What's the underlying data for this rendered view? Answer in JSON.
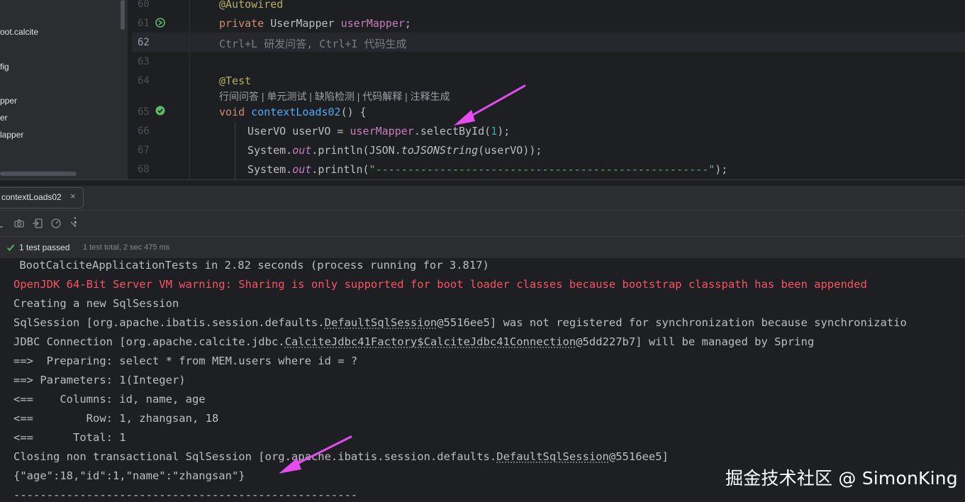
{
  "project_tree": {
    "items": [
      "oot.calcite",
      "fig",
      "pper",
      "er",
      "lapper"
    ]
  },
  "editor": {
    "line_numbers": [
      "60",
      "61",
      "62",
      "63",
      "64",
      "65",
      "66",
      "67",
      "68"
    ],
    "lines": {
      "l60": "@Autowired",
      "l61_kw": "private",
      "l61_type": " UserMapper ",
      "l61_field": "userMapper",
      "l61_end": ";",
      "l62_hint": "Ctrl+L 研发问答, Ctrl+I 代码生成",
      "l64": "@Test",
      "inlay": "行间问答 | 单元测试 | 缺陷检测 | 代码解释 | 注释生成",
      "l65_kw": "void",
      "l65_fn": " contextLoads02",
      "l65_end": "() {",
      "l66_a": "UserVO userVO = ",
      "l66_field": "userMapper",
      "l66_b": ".selectById(",
      "l66_num": "1",
      "l66_c": ");",
      "l67_a": "System.",
      "l67_out": "out",
      "l67_b": ".println(JSON.",
      "l67_fn": "toJSONString",
      "l67_c": "(userVO));",
      "l68_a": "System.",
      "l68_out": "out",
      "l68_b": ".println(",
      "l68_str": "\"----------------------------------------------------\"",
      "l68_c": ");"
    }
  },
  "run_window": {
    "tab_label": "contextLoads02",
    "tab_close": "×",
    "status_passed": "1 test passed",
    "status_summary": "1 test total, 2 sec 475 ms",
    "more_menu": "⋮"
  },
  "console": {
    "l1": " BootCalciteApplicationTests in 2.82 seconds (process running for 3.817)",
    "l2": "OpenJDK 64-Bit Server VM warning: Sharing is only supported for boot loader classes because bootstrap classpath has been appended",
    "l3": "Creating a new SqlSession",
    "l4_a": "SqlSession [org.apache.ibatis.session.defaults.",
    "l4_link": "DefaultSqlSession",
    "l4_b": "@5516ee5] was not registered for synchronization because synchronizatio",
    "l5_a": "JDBC Connection [org.apache.calcite.jdbc.",
    "l5_link": "CalciteJdbc41Factory$CalciteJdbc41Connection",
    "l5_b": "@5dd227b7] will be managed by Spring",
    "l6": "==>  Preparing: select * from MEM.users where id = ?",
    "l7": "==> Parameters: 1(Integer)",
    "l8": "<==    Columns: id, name, age",
    "l9": "<==        Row: 1, zhangsan, 18",
    "l10": "<==      Total: 1",
    "l11_a": "Closing non transactional SqlSession [org.apache.ibatis.session.defaults.",
    "l11_link": "DefaultSqlSession",
    "l11_b": "@5516ee5]",
    "l12": "{\"age\":18,\"id\":1,\"name\":\"zhangsan\"}",
    "l13": "----------------------------------------------------"
  },
  "watermark": "掘金技术社区 @ SimonKing",
  "colors": {
    "arrow": "#e44cf0",
    "error": "#f75464",
    "passed": "#5fb865"
  }
}
